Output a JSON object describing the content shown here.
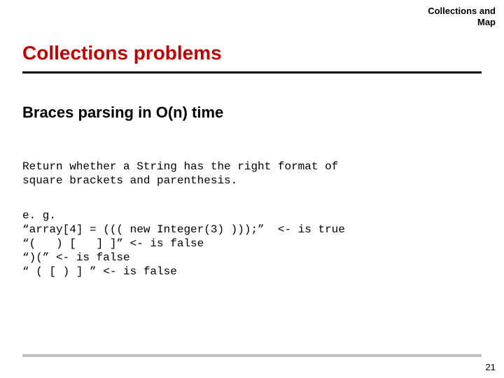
{
  "meta": {
    "line1": "Collections and",
    "line2": "Map"
  },
  "title": "Collections problems",
  "subtitle": "Braces parsing in O(n) time",
  "paragraph1": "Return whether a String has the right format of\nsquare brackets and parenthesis.",
  "paragraph2": "e. g.\n“array[4] = ((( new Integer(3) )));”  <- is true\n“(   ) [   ] ]” <- is false\n“)(” <- is false\n“ ( [ ) ] ” <- is false",
  "page_number": "21"
}
